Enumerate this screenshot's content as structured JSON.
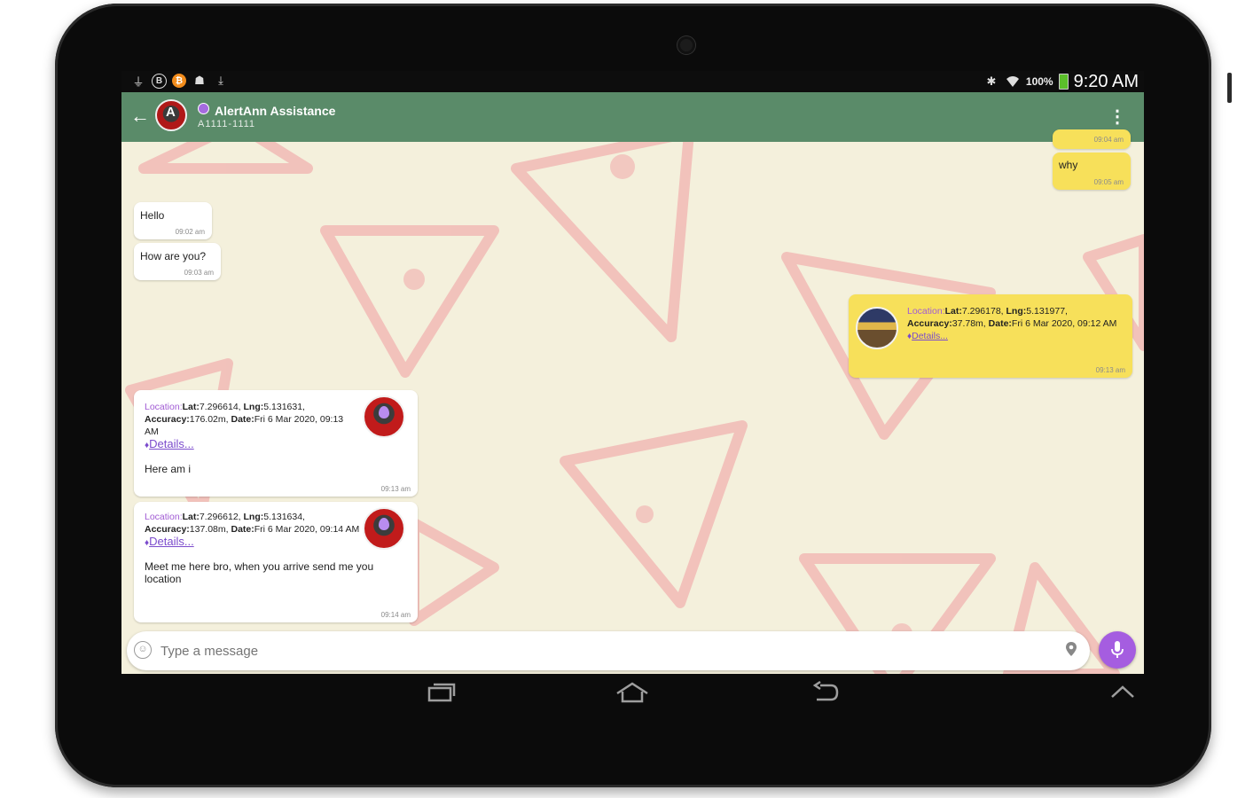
{
  "status_bar": {
    "left_icons": [
      "usb-icon",
      "b-icon",
      "bitcoin-icon",
      "android-icon",
      "download-icon"
    ],
    "battery_percent": "100%",
    "time": "9:20 AM"
  },
  "app_bar": {
    "title": "AlertAnn Assistance",
    "subtitle": "A1111-1111"
  },
  "messages": {
    "top_out_time": "09:04 am",
    "why": {
      "text": "why",
      "time": "09:05 am"
    },
    "hello": {
      "text": "Hello",
      "time": "09:02 am"
    },
    "how": {
      "text": "How are you?",
      "time": "09:03 am"
    },
    "out_location": {
      "label": "Location:",
      "lat_key": "Lat:",
      "lat": "7.296178,",
      "lng_key": "Lng:",
      "lng": "5.131977,",
      "acc_key": "Accuracy:",
      "acc": "37.78m,",
      "date_key": "Date:",
      "date": "Fri 6 Mar 2020, 09:12 AM",
      "details": "Details...",
      "time": "09:13 am"
    },
    "in_location_1": {
      "label": "Location:",
      "lat_key": "Lat:",
      "lat": "7.296614,",
      "lng_key": "Lng:",
      "lng": "5.131631,",
      "acc_key": "Accuracy:",
      "acc": "176.02m,",
      "date_key": "Date:",
      "date": "Fri 6 Mar 2020, 09:13 AM",
      "details": "Details...",
      "body": "Here am i",
      "time": "09:13 am"
    },
    "in_location_2": {
      "label": "Location:",
      "lat_key": "Lat:",
      "lat": "7.296612,",
      "lng_key": "Lng:",
      "lng": "5.131634,",
      "acc_key": "Accuracy:",
      "acc": "137.08m,",
      "date_key": "Date:",
      "date": "Fri 6 Mar 2020, 09:14 AM",
      "details": "Details...",
      "body": "Meet me here bro, when you arrive send me you location",
      "time": "09:14 am"
    }
  },
  "input": {
    "placeholder": "Type a message"
  },
  "colors": {
    "app_bar": "#5a8b69",
    "outgoing_bubble": "#f7e05a",
    "incoming_bubble": "#ffffff",
    "accent": "#a55de0",
    "wallpaper": "#f4f0dc"
  }
}
